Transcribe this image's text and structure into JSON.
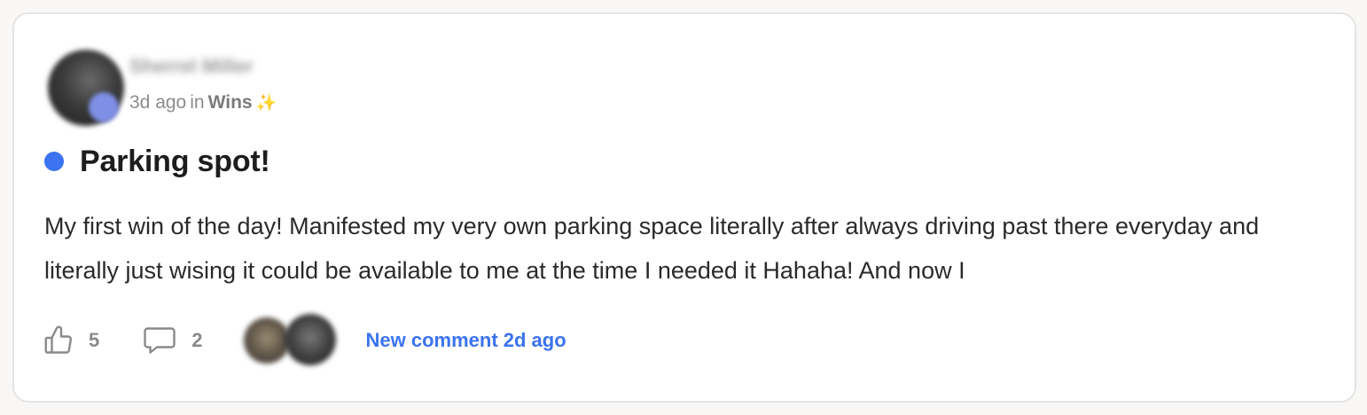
{
  "post": {
    "author_name": "Sherrel Miller",
    "time_ago": "3d ago",
    "in_text": "in",
    "category": "Wins",
    "category_emoji": "✨",
    "title": "Parking spot!",
    "body": "My first win of the day! Manifested my very own parking space literally after always driving past there everyday and literally just wising it could be available to me at the time I needed it Hahaha! And now I"
  },
  "footer": {
    "like_count": "5",
    "comment_count": "2",
    "new_comment_label": "New comment 2d ago"
  },
  "icons": {
    "like": "thumbs-up-icon",
    "comment": "speech-bubble-icon"
  },
  "colors": {
    "accent": "#3b73f0",
    "unread_dot": "#3b73f0",
    "muted_text": "#8d8d8d"
  }
}
